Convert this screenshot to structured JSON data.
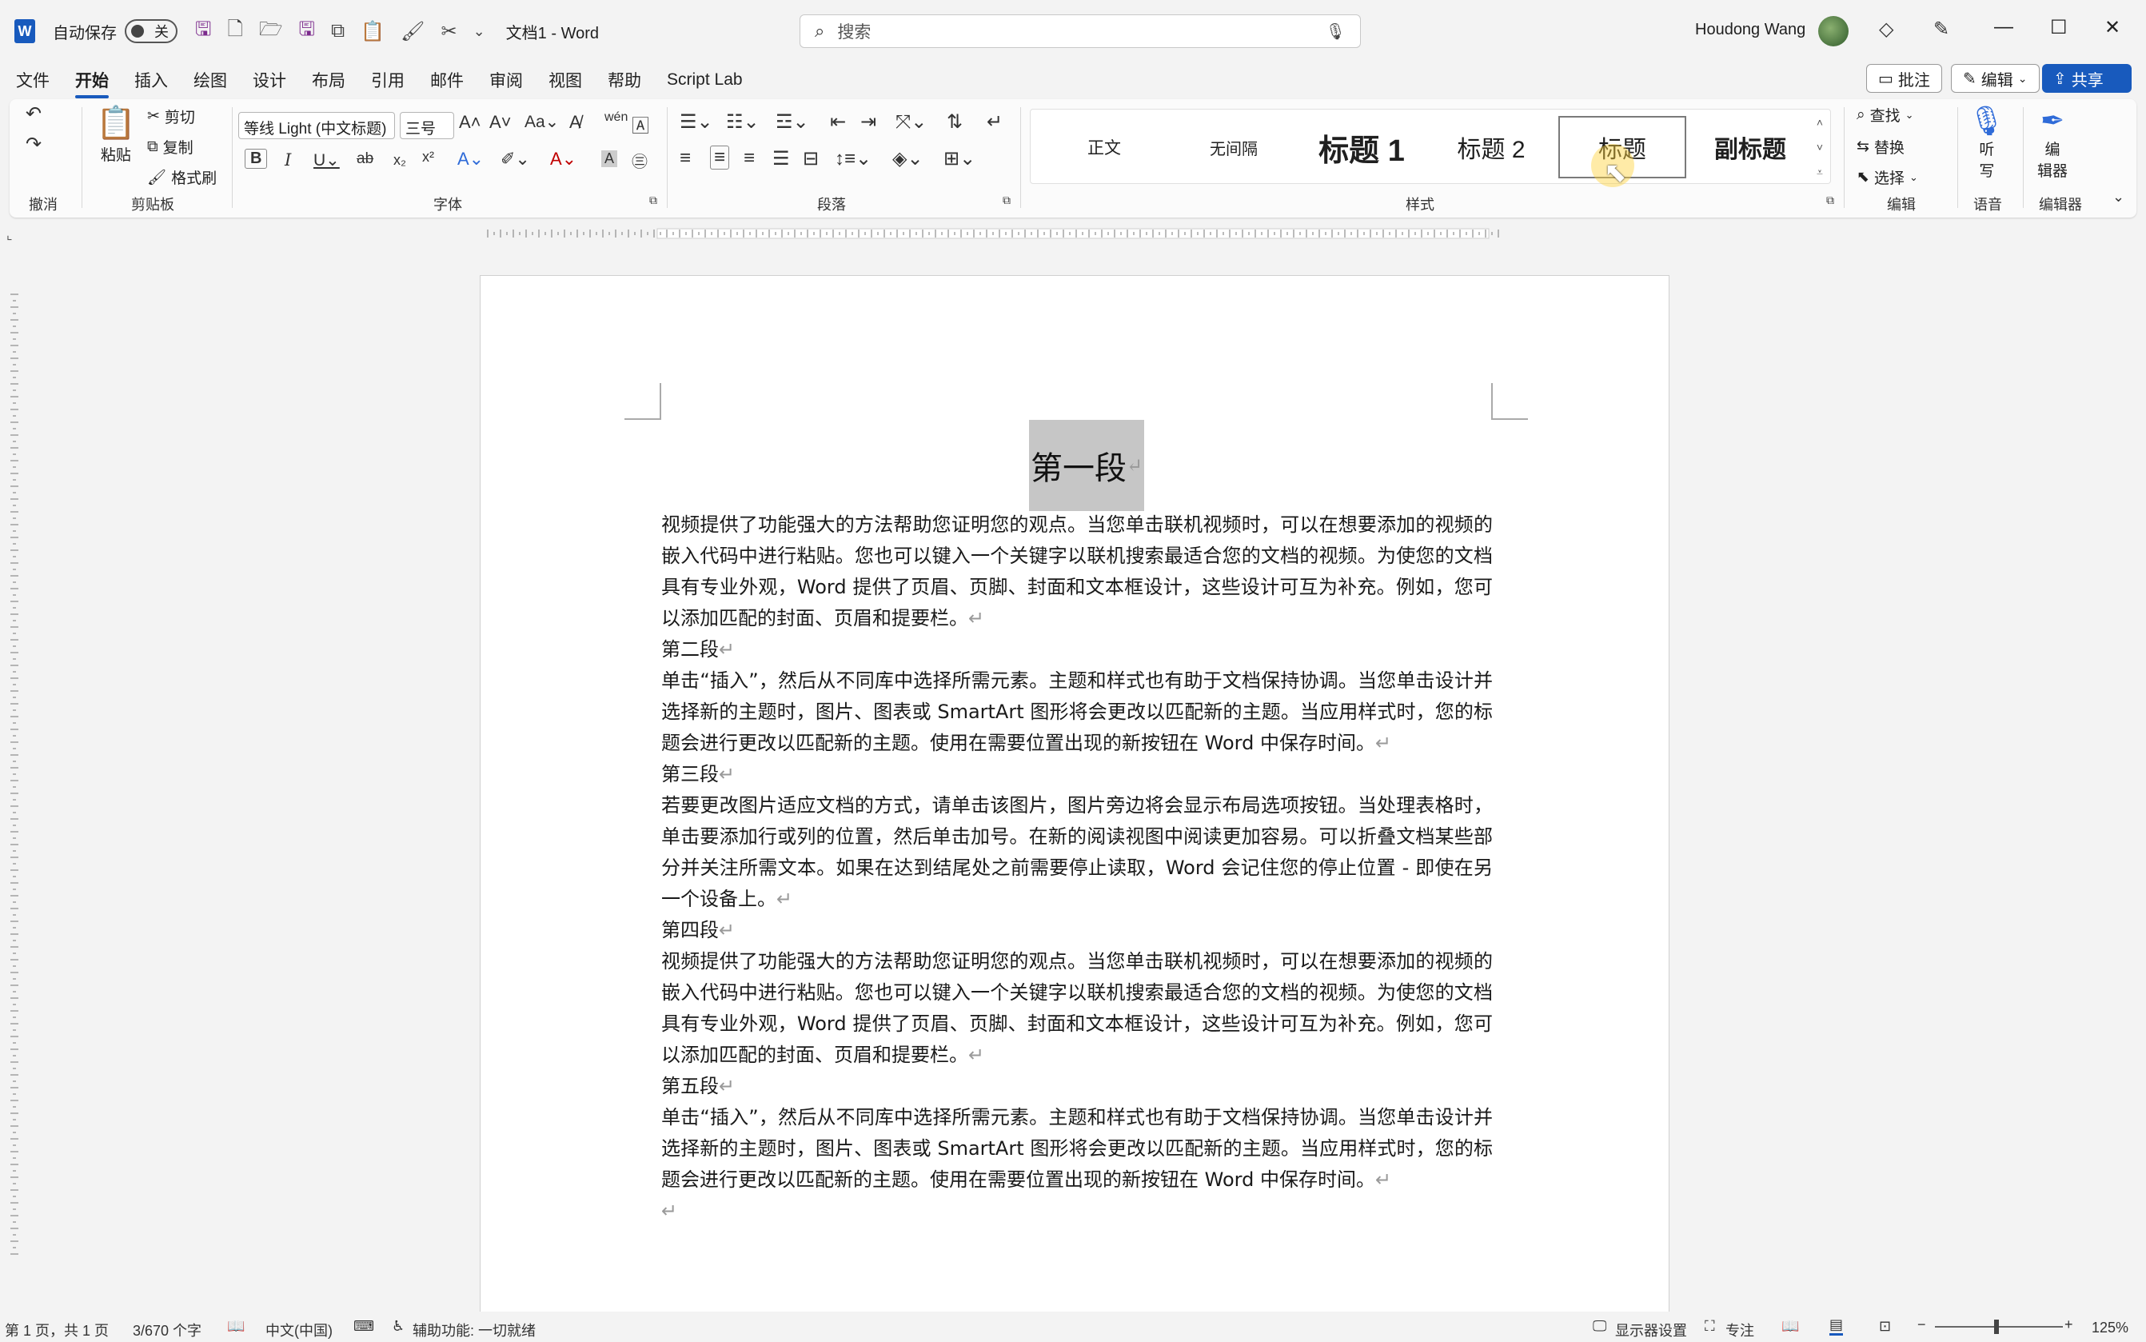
{
  "titlebar": {
    "app_icon": "W",
    "autosave_label": "自动保存",
    "autosave_state": "关",
    "doc_title": "文档1 - Word",
    "search_placeholder": "搜索",
    "user_name": "Houdong Wang"
  },
  "menu": {
    "tabs": [
      "文件",
      "开始",
      "插入",
      "绘图",
      "设计",
      "布局",
      "引用",
      "邮件",
      "审阅",
      "视图",
      "帮助",
      "Script Lab"
    ],
    "comment_label": "批注",
    "edit_label": "编辑",
    "share_label": "共享"
  },
  "ribbon": {
    "undo_group": "撤消",
    "clipboard": {
      "group": "剪贴板",
      "paste": "粘贴",
      "cut": "剪切",
      "copy": "复制",
      "format_painter": "格式刷"
    },
    "font": {
      "group": "字体",
      "font_name": "等线 Light (中文标题)",
      "font_size": "三号"
    },
    "paragraph_group": "段落",
    "styles": {
      "group": "样式",
      "items": [
        "正文",
        "无间隔",
        "标题 1",
        "标题 2",
        "标题",
        "副标题"
      ]
    },
    "editing": {
      "group": "编辑",
      "find": "查找",
      "replace": "替换",
      "select": "选择"
    },
    "voice": {
      "group": "语音",
      "dictate_1": "听",
      "dictate_2": "写"
    },
    "editor": {
      "group": "编辑器",
      "label_1": "编",
      "label_2": "辑器"
    }
  },
  "document": {
    "heading": "第一段",
    "paragraphs": [
      {
        "type": "body",
        "text": "视频提供了功能强大的方法帮助您证明您的观点。当您单击联机视频时，可以在想要添加的视频的嵌入代码中进行粘贴。您也可以键入一个关键字以联机搜索最适合您的文档的视频。为使您的文档具有专业外观，Word 提供了页眉、页脚、封面和文本框设计，这些设计可互为补充。例如，您可以添加匹配的封面、页眉和提要栏。"
      },
      {
        "type": "label",
        "text": "第二段"
      },
      {
        "type": "body",
        "text": "单击“插入”，然后从不同库中选择所需元素。主题和样式也有助于文档保持协调。当您单击设计并选择新的主题时，图片、图表或 SmartArt 图形将会更改以匹配新的主题。当应用样式时，您的标题会进行更改以匹配新的主题。使用在需要位置出现的新按钮在 Word 中保存时间。"
      },
      {
        "type": "label",
        "text": "第三段"
      },
      {
        "type": "body",
        "text": "若要更改图片适应文档的方式，请单击该图片，图片旁边将会显示布局选项按钮。当处理表格时，单击要添加行或列的位置，然后单击加号。在新的阅读视图中阅读更加容易。可以折叠文档某些部分并关注所需文本。如果在达到结尾处之前需要停止读取，Word 会记住您的停止位置 - 即使在另一个设备上。"
      },
      {
        "type": "label",
        "text": "第四段"
      },
      {
        "type": "body",
        "text": "视频提供了功能强大的方法帮助您证明您的观点。当您单击联机视频时，可以在想要添加的视频的嵌入代码中进行粘贴。您也可以键入一个关键字以联机搜索最适合您的文档的视频。为使您的文档具有专业外观，Word 提供了页眉、页脚、封面和文本框设计，这些设计可互为补充。例如，您可以添加匹配的封面、页眉和提要栏。"
      },
      {
        "type": "label",
        "text": "第五段"
      },
      {
        "type": "body",
        "text": "单击“插入”，然后从不同库中选择所需元素。主题和样式也有助于文档保持协调。当您单击设计并选择新的主题时，图片、图表或 SmartArt 图形将会更改以匹配新的主题。当应用样式时，您的标题会进行更改以匹配新的主题。使用在需要位置出现的新按钮在 Word 中保存时间。"
      }
    ]
  },
  "statusbar": {
    "page": "第 1 页，共 1 页",
    "words": "3/670 个字",
    "language": "中文(中国)",
    "accessibility": "辅助功能: 一切就绪",
    "display_settings": "显示器设置",
    "focus": "专注",
    "zoom": "125%"
  }
}
